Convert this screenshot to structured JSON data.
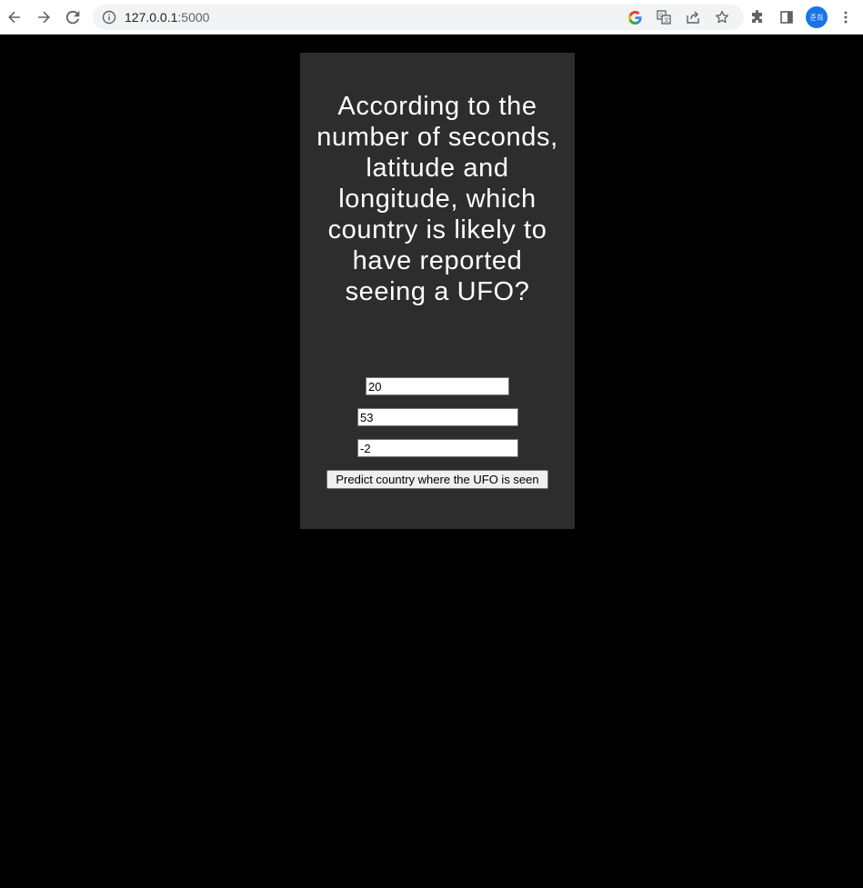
{
  "browser": {
    "url_host": "127.0.0.1",
    "url_port": ":5000",
    "profile_initials": "준희",
    "icons": {
      "back": "back-arrow-icon",
      "forward": "forward-arrow-icon",
      "reload": "reload-icon",
      "info": "info-icon",
      "google": "google-icon",
      "translate": "translate-icon",
      "share": "share-icon",
      "bookmark": "star-icon",
      "extensions": "puzzle-icon",
      "side_panel": "side-panel-icon",
      "menu": "kebab-menu-icon"
    }
  },
  "page": {
    "heading": "According to the number of seconds, latitude and longitude, which country is likely to have reported seeing a UFO?",
    "inputs": {
      "seconds": "20",
      "latitude": "53",
      "longitude": "-2"
    },
    "submit_label": "Predict country where the UFO is seen",
    "colors": {
      "background": "#000000",
      "panel": "#2d2d2d",
      "text": "#ffffff"
    }
  }
}
